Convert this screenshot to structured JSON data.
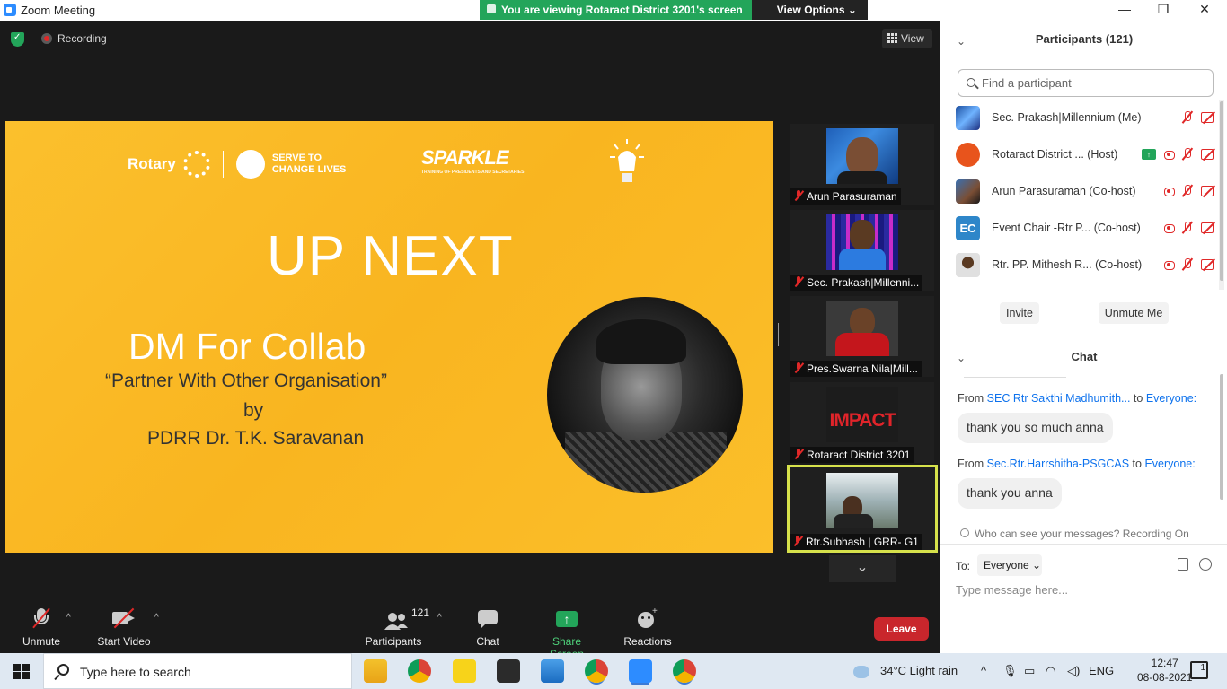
{
  "window": {
    "title": "Zoom Meeting",
    "banner": "You are viewing Rotaract District 3201's screen",
    "view_options": "View Options ⌄",
    "minimize": "—",
    "maximize": "❐",
    "close": "✕"
  },
  "meeting": {
    "recording": "Recording",
    "view_label": "View"
  },
  "slide": {
    "rotary": "Rotary",
    "serve_line1": "SERVE TO",
    "serve_line2": "CHANGE LIVES",
    "sparkle": "SPARKLE",
    "sparkle_sub": "TRAINING OF PRESIDENTS AND SECRETARIES",
    "up_next": "UP NEXT",
    "session": "DM For Collab",
    "subtitle": "“Partner With Other Organisation”",
    "by": "by",
    "speaker": "PDRR Dr. T.K. Saravanan"
  },
  "thumbnails": [
    {
      "name": "Arun Parasuraman"
    },
    {
      "name": "Sec. Prakash|Millenni..."
    },
    {
      "name": "Pres.Swarna Nila|Mill..."
    },
    {
      "name": "Rotaract District 3201",
      "logo_text": "IMPACT"
    },
    {
      "name": "Rtr.Subhash | GRR- G1"
    }
  ],
  "thumbnails_more": "⌄",
  "toolbar": {
    "unmute": "Unmute",
    "start_video": "Start Video",
    "participants": "Participants",
    "participants_count": "121",
    "chat": "Chat",
    "share_screen": "Share Screen",
    "reactions": "Reactions",
    "leave": "Leave",
    "caret": "^"
  },
  "participants_panel": {
    "title": "Participants (121)",
    "search_placeholder": "Find a participant",
    "rows": [
      {
        "name": "Sec. Prakash|Millennium (Me)",
        "avatar": "#1c4fa0"
      },
      {
        "name": "Rotaract District ... (Host)",
        "avatar": "#e8541c"
      },
      {
        "name": "Arun Parasuraman (Co-host)",
        "avatar": "#3a6fb0"
      },
      {
        "name": "Event Chair -Rtr P... (Co-host)",
        "avatar": "#2e86c9",
        "initials": "EC"
      },
      {
        "name": "Rtr. PP. Mithesh R... (Co-host)",
        "avatar": "#d9d9d9"
      }
    ],
    "invite": "Invite",
    "unmute_me": "Unmute Me"
  },
  "chat": {
    "title": "Chat",
    "messages": [
      {
        "from_label": "From",
        "sender": "SEC Rtr Sakthi Madhumith...",
        "to_label": "to",
        "to": "Everyone:",
        "text": "thank you so much anna"
      },
      {
        "from_label": "From",
        "sender": "Sec.Rtr.Harrshitha-PSGCAS",
        "to_label": "to",
        "to": "Everyone:",
        "text": "thank you anna"
      }
    ],
    "who_can_see": "Who can see your messages? Recording On",
    "to_label": "To:",
    "to_value": "Everyone ⌄",
    "placeholder": "Type message here..."
  },
  "taskbar": {
    "search": "Type here to search",
    "weather": "34°C  Light rain",
    "lang": "ENG",
    "time": "12:47",
    "date": "08-08-2021",
    "notifications": "1"
  },
  "colors": {
    "zoom_blue": "#2d8cff",
    "banner_green": "#23a55a",
    "leave_red": "#c9262c",
    "slide_yellow": "#fbbf2a",
    "muted_red": "#e02828",
    "active_speaker": "#d6e14b"
  }
}
